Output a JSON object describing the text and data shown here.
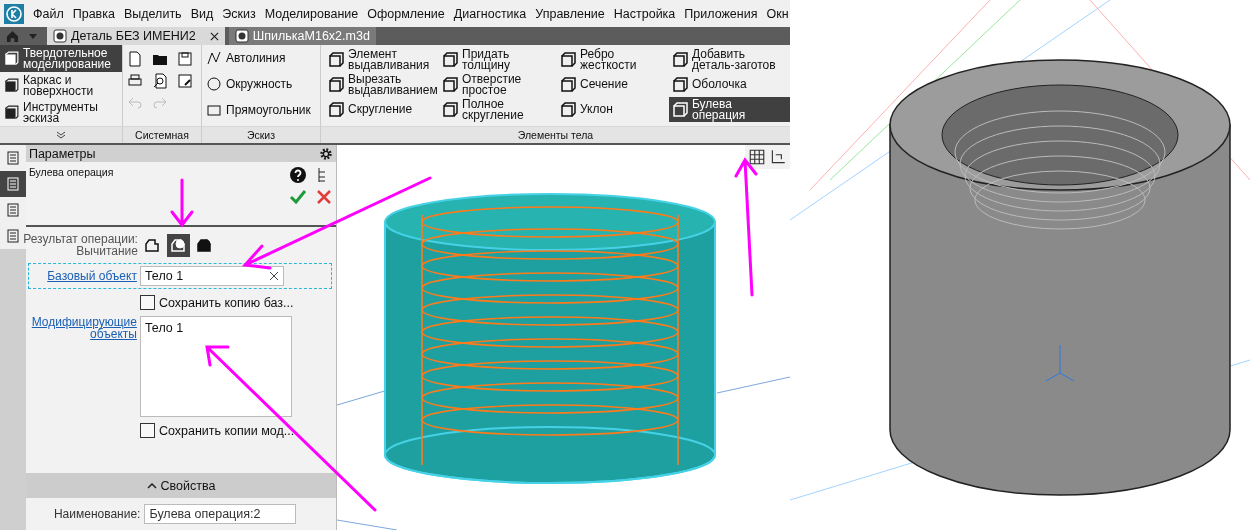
{
  "menu": [
    "Файл",
    "Правка",
    "Выделить",
    "Вид",
    "Эскиз",
    "Моделирование",
    "Оформление",
    "Диагностика",
    "Управление",
    "Настройка",
    "Приложения",
    "Окн"
  ],
  "tabs": [
    {
      "label": "Деталь БЕЗ ИМЕНИ2",
      "selected": true
    },
    {
      "label": "ШпилькаM16x2.m3d",
      "selected": false
    }
  ],
  "ribbon": {
    "modes": [
      {
        "label": "Твердотельное моделирование",
        "selected": true
      },
      {
        "label": "Каркас и поверхности",
        "selected": false
      },
      {
        "label": "Инструменты эскиза",
        "selected": false
      }
    ],
    "system_group": {
      "title": "Системная"
    },
    "sketch_group": {
      "title": "Эскиз",
      "tools": [
        {
          "label": "Автолиния"
        },
        {
          "label": "Окружность"
        },
        {
          "label": "Прямоугольник"
        }
      ]
    },
    "body_group": {
      "title": "Элементы тела",
      "tools": [
        {
          "label": "Элемент выдавливания",
          "selected": false
        },
        {
          "label": "Вырезать выдавливанием",
          "selected": false
        },
        {
          "label": "Скругление",
          "selected": false
        },
        {
          "label": "Придать толщину",
          "selected": false
        },
        {
          "label": "Отверстие простое",
          "selected": false
        },
        {
          "label": "Полное скругление",
          "selected": false
        },
        {
          "label": "Ребро жесткости",
          "selected": false
        },
        {
          "label": "Сечение",
          "selected": false
        },
        {
          "label": "Уклон",
          "selected": false
        },
        {
          "label": "Добавить деталь-заготов",
          "selected": false
        },
        {
          "label": "Оболочка",
          "selected": false
        },
        {
          "label": "Булева операция",
          "selected": true
        }
      ]
    }
  },
  "side_tabs": [
    {
      "selected": false
    },
    {
      "selected": true
    },
    {
      "selected": false
    },
    {
      "selected": false
    }
  ],
  "panel": {
    "title": "Параметры",
    "operation": "Булева операция",
    "result_label": "Результат операции:",
    "result_value": "Вычитание",
    "result_options": [
      {
        "selected": false
      },
      {
        "selected": true
      },
      {
        "selected": false
      }
    ],
    "base_object": {
      "label": "Базовый объект",
      "value": "Тело 1"
    },
    "keep_base": {
      "label": "Сохранить копию баз...",
      "checked": false
    },
    "modifying": {
      "label": "Модифицирующие объекты",
      "items": [
        "Тело 1"
      ]
    },
    "keep_modifying": {
      "label": "Сохранить копии мод...",
      "checked": false
    },
    "properties": {
      "title": "Свойства",
      "expanded": true,
      "name_label": "Наименование:",
      "name_value": "Булева операция:2"
    }
  }
}
